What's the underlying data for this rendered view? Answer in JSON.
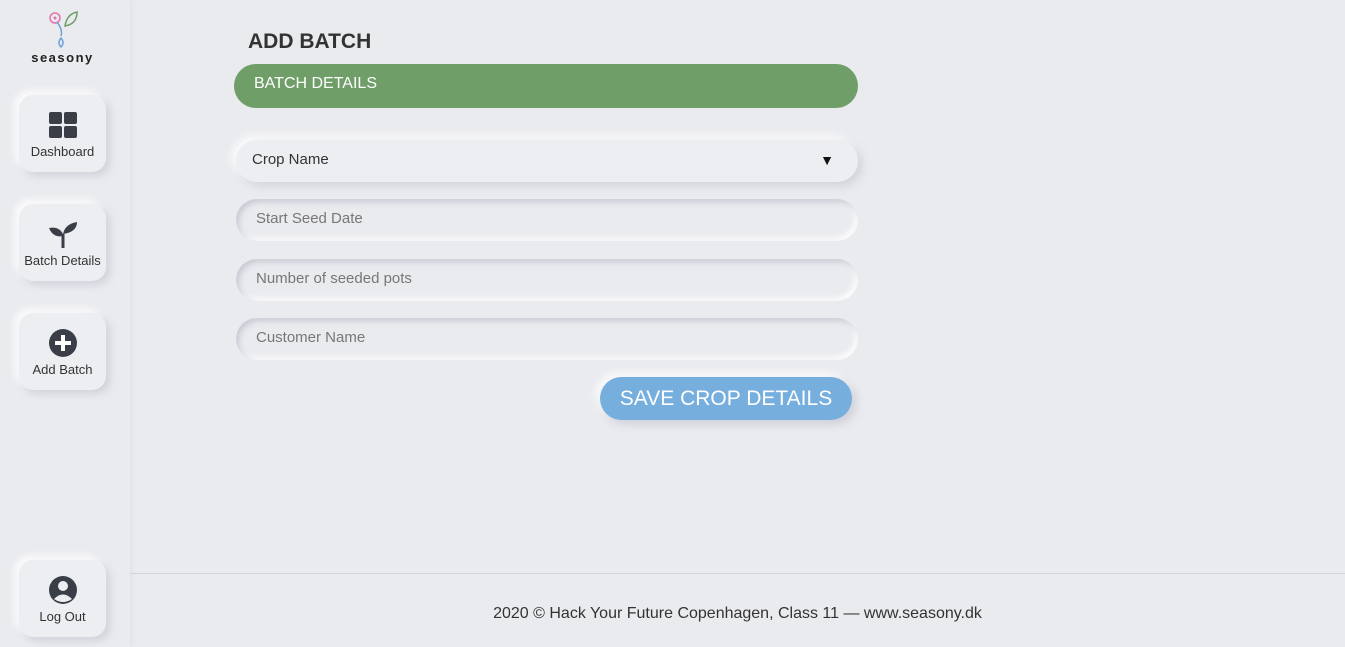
{
  "brand": {
    "name": "seasony"
  },
  "sidebar": {
    "items": [
      {
        "label": "Dashboard",
        "icon": "dashboard-grid-icon"
      },
      {
        "label": "Batch Details",
        "icon": "sprout-icon"
      },
      {
        "label": "Add Batch",
        "icon": "plus-circle-icon"
      }
    ],
    "logout": {
      "label": "Log Out",
      "icon": "user-circle-icon"
    }
  },
  "page": {
    "title": "ADD BATCH",
    "section_label": "BATCH DETAILS"
  },
  "form": {
    "crop_select": {
      "value": "Crop Name",
      "caret": "▼"
    },
    "start_seed_date": {
      "placeholder": "Start Seed Date"
    },
    "seeded_pots": {
      "placeholder": "Number of seeded pots"
    },
    "customer_name": {
      "placeholder": "Customer Name"
    },
    "save_label": "SAVE CROP DETAILS"
  },
  "footer": {
    "text": "2020 © Hack Your Future Copenhagen, Class 11 — www.seasony.dk"
  },
  "colors": {
    "background": "#eaebef",
    "section_green": "#6f9e69",
    "button_blue": "#76aedd"
  }
}
